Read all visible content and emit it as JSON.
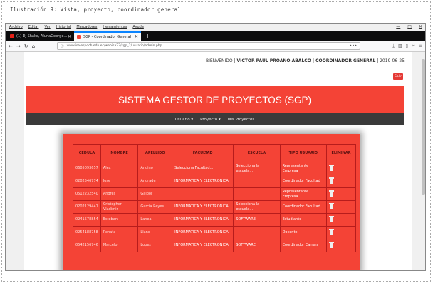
{
  "caption": "Ilustración 9: Vista, proyecto, coordinador general",
  "menubar": {
    "items": [
      "Archivo",
      "Editar",
      "Ver",
      "Historial",
      "Marcadores",
      "Herramientas",
      "Ayuda"
    ]
  },
  "window_controls": [
    "—",
    "□",
    "✕"
  ],
  "tabs": [
    {
      "label": "(1) DJ Shake, AlunaGeorge...",
      "close": "✕"
    },
    {
      "label": "SGP - Coordinador General",
      "close": "✕"
    }
  ],
  "newtab": "+",
  "nav": {
    "back": "←",
    "forward": "→",
    "reload": "↻",
    "home": "⌂",
    "url": "www.isa.espoch.edu.ec/webisa23/sgp_2/usuario/admin.php",
    "url_menu": "•••"
  },
  "site": {
    "welcome_prefix": "BIENVENIDO |",
    "welcome_user": "VICTOR PAUL PROAÑO ABALCO | COORDINADOR GENERAL",
    "welcome_date": "| 2019-06-25",
    "logout": "Salir",
    "title": "SISTEMA GESTOR DE PROYECTOS (SGP)",
    "menu": [
      "Usuario ▾",
      "Proyecto ▾",
      "Mis Proyectos"
    ]
  },
  "table": {
    "headers": [
      "CEDULA",
      "NOMBRE",
      "APELLIDO",
      "FACULTAD",
      "ESCUELA",
      "TIPO USUARIO",
      "ELIMINAR"
    ],
    "rows": [
      [
        "0605093657",
        "Alex",
        "Andino",
        "Selecciona Facultad...",
        "Selecciona la escuela...",
        "Representante Empresa"
      ],
      [
        "0202546774",
        "Jose",
        "Andrade",
        "INFORMATICA Y ELECTRONICA",
        "",
        "Coordinador Facultad"
      ],
      [
        "0512232540",
        "Andres",
        "Gaibor",
        "",
        "",
        "Representante Empresa"
      ],
      [
        "0202129441",
        "Cristopher Vladimir",
        "Garcia Reyes",
        "INFORMATICA Y ELECTRONICA",
        "Selecciona la escuela...",
        "Coordinador Facultad"
      ],
      [
        "0241578854",
        "Esteban",
        "Lanea",
        "INFORMATICA Y ELECTRONICA",
        "SOFTWARE",
        "Estudiante"
      ],
      [
        "0254188758",
        "Renata",
        "Llano",
        "INFORMATICA Y ELECTRONICA",
        "",
        "Docente"
      ],
      [
        "0542156746",
        "Marcelo",
        "Lopez",
        "INFORMATICA Y ELECTRONICA",
        "SOFTWARE",
        "Coordinador Carrera"
      ]
    ]
  }
}
